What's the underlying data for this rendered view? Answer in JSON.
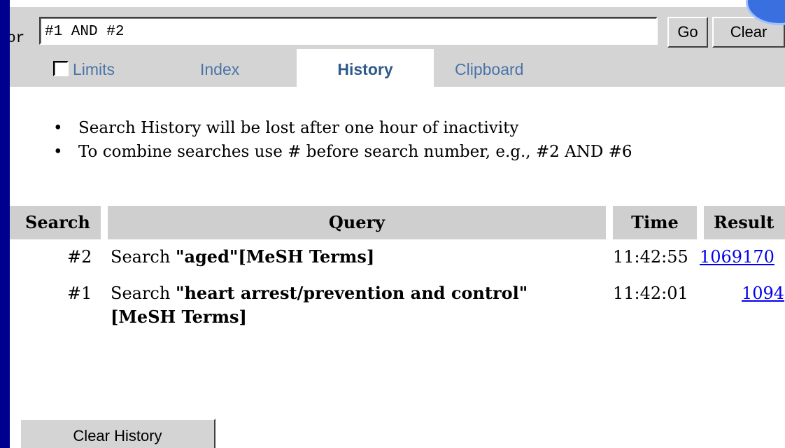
{
  "search": {
    "label_fragment": "or",
    "query_value": "#1 AND #2",
    "go_label": "Go",
    "clear_label": "Clear"
  },
  "tabs": [
    {
      "label": "Limits",
      "has_checkbox": true,
      "checked": false,
      "active": false
    },
    {
      "label": "Index",
      "active": false
    },
    {
      "label": "History",
      "active": true
    },
    {
      "label": "Clipboard",
      "active": false
    }
  ],
  "notes": [
    "Search History will be lost after one hour of inactivity",
    "To combine searches use # before search number, e.g., #2 AND #6"
  ],
  "history_table": {
    "headers": [
      "Search",
      "Query",
      "Time",
      "Result"
    ],
    "rows": [
      {
        "number": "#2",
        "prefix": "Search",
        "term": "\"aged\"[MeSH Terms]",
        "time": "11:42:55",
        "result": "1069170"
      },
      {
        "number": "#1",
        "prefix": "Search",
        "term": "\"heart arrest/prevention and control\"[MeSH Terms]",
        "time": "11:42:01",
        "result": "1094"
      }
    ]
  },
  "clear_history_label": "Clear History",
  "colors": {
    "background_blue": "#00008f",
    "tab_text": "#4a74a8",
    "link": "#0000ee",
    "toolbar_gray": "#d4d4d4"
  }
}
